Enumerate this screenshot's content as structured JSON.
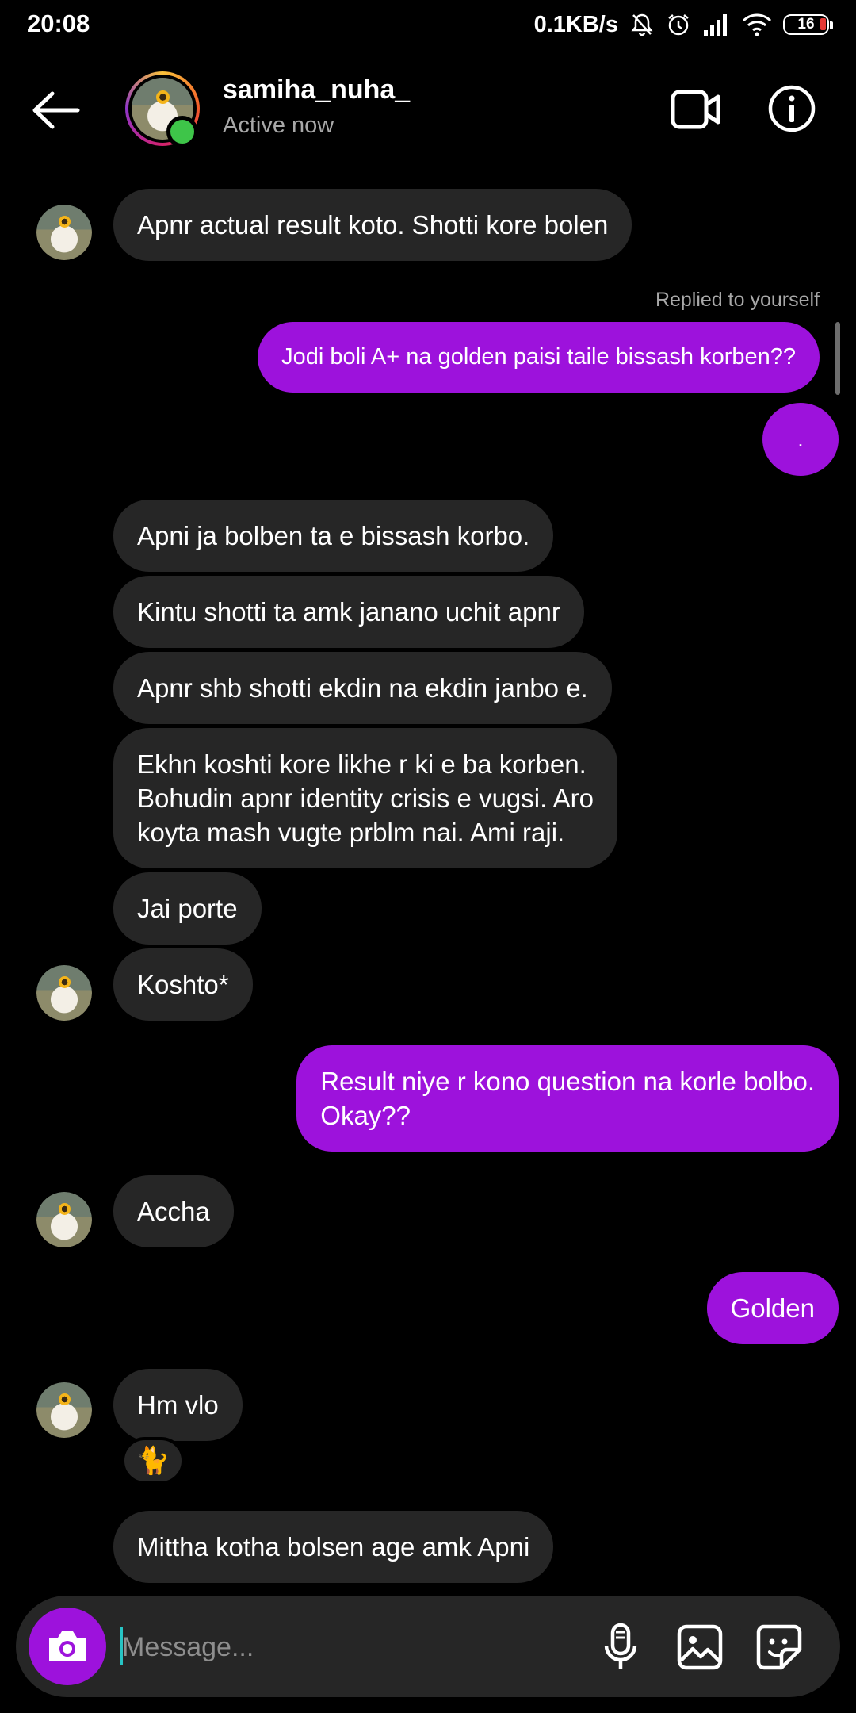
{
  "status_bar": {
    "time": "20:08",
    "net_speed": "0.1KB/s",
    "battery": "16"
  },
  "header": {
    "username": "samiha_nuha_",
    "status": "Active now"
  },
  "messages": [
    {
      "dir": "in",
      "text": "Apnr actual result koto. Shotti kore bolen"
    },
    {
      "dir": "note",
      "text": "Replied to yourself"
    },
    {
      "dir": "out",
      "text": "Jodi boli A+ na golden paisi taile bissash korben??"
    },
    {
      "dir": "out",
      "text": "."
    },
    {
      "dir": "in",
      "text": "Apni ja bolben ta e bissash korbo."
    },
    {
      "dir": "in",
      "text": "Kintu shotti ta amk janano uchit apnr"
    },
    {
      "dir": "in",
      "text": "Apnr shb shotti ekdin na ekdin janbo e."
    },
    {
      "dir": "in",
      "text": "Ekhn koshti kore likhe r ki e ba korben.\nBohudin apnr identity crisis e vugsi. Aro\nkoyta mash vugte prblm nai. Ami raji."
    },
    {
      "dir": "in",
      "text": "Jai porte"
    },
    {
      "dir": "in",
      "text": "Koshto*"
    },
    {
      "dir": "out",
      "text": "Result niye r kono question na korle bolbo.\nOkay??"
    },
    {
      "dir": "in",
      "text": "Accha"
    },
    {
      "dir": "out",
      "text": "Golden"
    },
    {
      "dir": "in",
      "text": "Hm vlo"
    },
    {
      "dir": "reaction",
      "text": "🐈"
    },
    {
      "dir": "in",
      "text": "Mittha kotha bolsen age amk Apni"
    }
  ],
  "composer": {
    "placeholder": "Message..."
  },
  "icons": {
    "back": "arrow-left-icon",
    "video": "video-call-icon",
    "info": "info-icon",
    "camera": "camera-icon",
    "mic": "microphone-icon",
    "gallery": "image-icon",
    "sticker": "sticker-icon"
  },
  "colors": {
    "outgoing_bubble": "#9d12dc",
    "incoming_bubble": "#262626",
    "online": "#3ec549"
  }
}
